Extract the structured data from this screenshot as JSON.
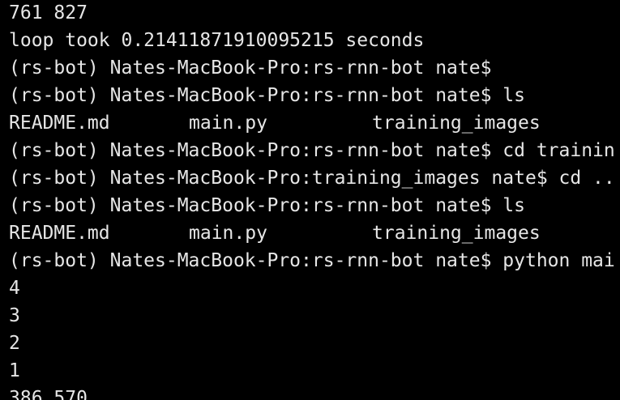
{
  "terminal": {
    "colors": {
      "background": "#000000",
      "foreground": "#e6e6e6"
    },
    "lines": [
      "761 827",
      "loop took 0.21411871910095215 seconds",
      "(rs-bot) Nates-MacBook-Pro:rs-rnn-bot nate$",
      "(rs-bot) Nates-MacBook-Pro:rs-rnn-bot nate$ ls",
      null,
      "(rs-bot) Nates-MacBook-Pro:rs-rnn-bot nate$ cd trainin",
      "(rs-bot) Nates-MacBook-Pro:training_images nate$ cd ..",
      "(rs-bot) Nates-MacBook-Pro:rs-rnn-bot nate$ ls",
      null,
      "(rs-bot) Nates-MacBook-Pro:rs-rnn-bot nate$ python mai",
      "4",
      "3",
      "2",
      "1",
      "386 570"
    ],
    "ls_output_1": [
      "README.md",
      "main.py",
      "training_images"
    ],
    "ls_output_2": [
      "README.md",
      "main.py",
      "training_images"
    ]
  }
}
